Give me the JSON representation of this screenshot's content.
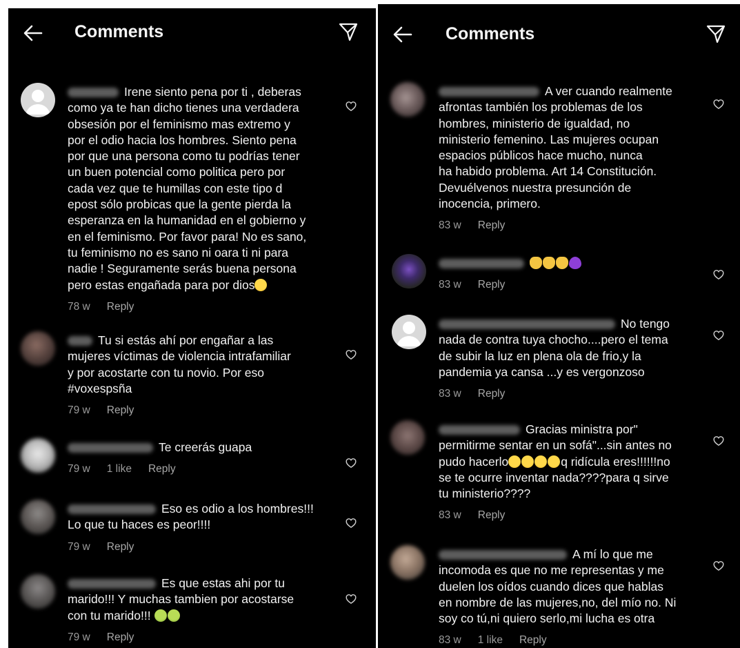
{
  "left": {
    "header": {
      "title": "Comments"
    },
    "comments": [
      {
        "lines": [
          "Irene siento pena por ti , deberas",
          "como ya te han dicho tienes una verdadera",
          "obsesión por el feminismo mas extremo y",
          "por el odio hacia los hombres. Siento pena",
          "por que una persona como tu podrías tener",
          "un buen potencial como politica pero por",
          "cada vez que te humillas con este tipo d",
          "epost sólo probicas que la gente pierda la",
          "esperanza en la humanidad en el gobierno y",
          "en el feminismo. Por favor para! No es sano,",
          "tu feminismo no es sano ni oara ti ni para",
          "nadie ! Seguramente serás buena persona",
          "pero estas engañada para por dios"
        ],
        "time": "78 w",
        "likes": "",
        "reply": "Reply"
      },
      {
        "lines": [
          "Tu si estás ahí por engañar a las",
          "mujeres víctimas de violencia intrafamiliar",
          "y por acostarte con tu novio. Por eso",
          "#voxespsña"
        ],
        "time": "79 w",
        "likes": "",
        "reply": "Reply"
      },
      {
        "lines": [
          "Te creerás guapa"
        ],
        "time": "79 w",
        "likes": "1 like",
        "reply": "Reply"
      },
      {
        "lines": [
          "Eso es odio a los hombres!!!",
          "Lo que tu haces es peor!!!!"
        ],
        "time": "79 w",
        "likes": "",
        "reply": "Reply"
      },
      {
        "lines": [
          "Es que estas ahi por tu",
          "marido!!! Y muchas tambien por acostarse",
          "con tu marido!!!"
        ],
        "time": "79 w",
        "likes": "",
        "reply": "Reply"
      }
    ]
  },
  "right": {
    "header": {
      "title": "Comments"
    },
    "comments": [
      {
        "lines": [
          "A ver cuando realmente",
          "afrontas también los problemas de los",
          "hombres, ministerio de igualdad, no",
          "ministerio femenino. Las mujeres ocupan",
          "espacios públicos hace mucho, nunca",
          "ha habido problema. Art 14 Constitución.",
          "Devuélvenos nuestra presunción de",
          "inocencia, primero."
        ],
        "time": "83 w",
        "likes": "",
        "reply": "Reply"
      },
      {
        "lines": [
          ""
        ],
        "time": "83 w",
        "likes": "",
        "reply": "Reply"
      },
      {
        "lines": [
          "No tengo",
          "nada de contra tuya chocho....pero el tema",
          "de subir la luz en plena ola de frio,y la",
          "pandemia ya cansa ...y es vergonzoso"
        ],
        "time": "83 w",
        "likes": "",
        "reply": "Reply"
      },
      {
        "lines": [
          "Gracias ministra por\"",
          "permitirme sentar en un sofá\"...sin antes no",
          "pudo hacerlo",
          "se te ocurre inventar nada????para q sirve",
          "tu ministerio????"
        ],
        "line3_tail": "q ridícula eres!!!!!!no",
        "time": "83 w",
        "likes": "",
        "reply": "Reply"
      },
      {
        "lines": [
          "A mí lo que me",
          "incomoda es que no me representas y me",
          "duelen los oídos cuando dices que hablas",
          "en nombre de las mujeres,no, del mío no. Ni",
          "soy co tú,ni quiero serlo,mi lucha es otra"
        ],
        "time": "83 w",
        "likes": "1 like",
        "reply": "Reply"
      }
    ]
  },
  "icons": {
    "back": "arrow-left-icon",
    "send": "paper-plane-icon",
    "like": "heart-outline-icon",
    "emoji_cry": "loudly-crying-face-emoji",
    "emoji_sick": "nauseated-face-emoji",
    "emoji_laugh": "tears-of-joy-emoji",
    "emoji_clap": "clapping-hands-emoji",
    "emoji_heart": "purple-heart-emoji"
  },
  "colors": {
    "background": "#000000",
    "text": "#f2f2f2",
    "meta": "#9b9b9b"
  }
}
